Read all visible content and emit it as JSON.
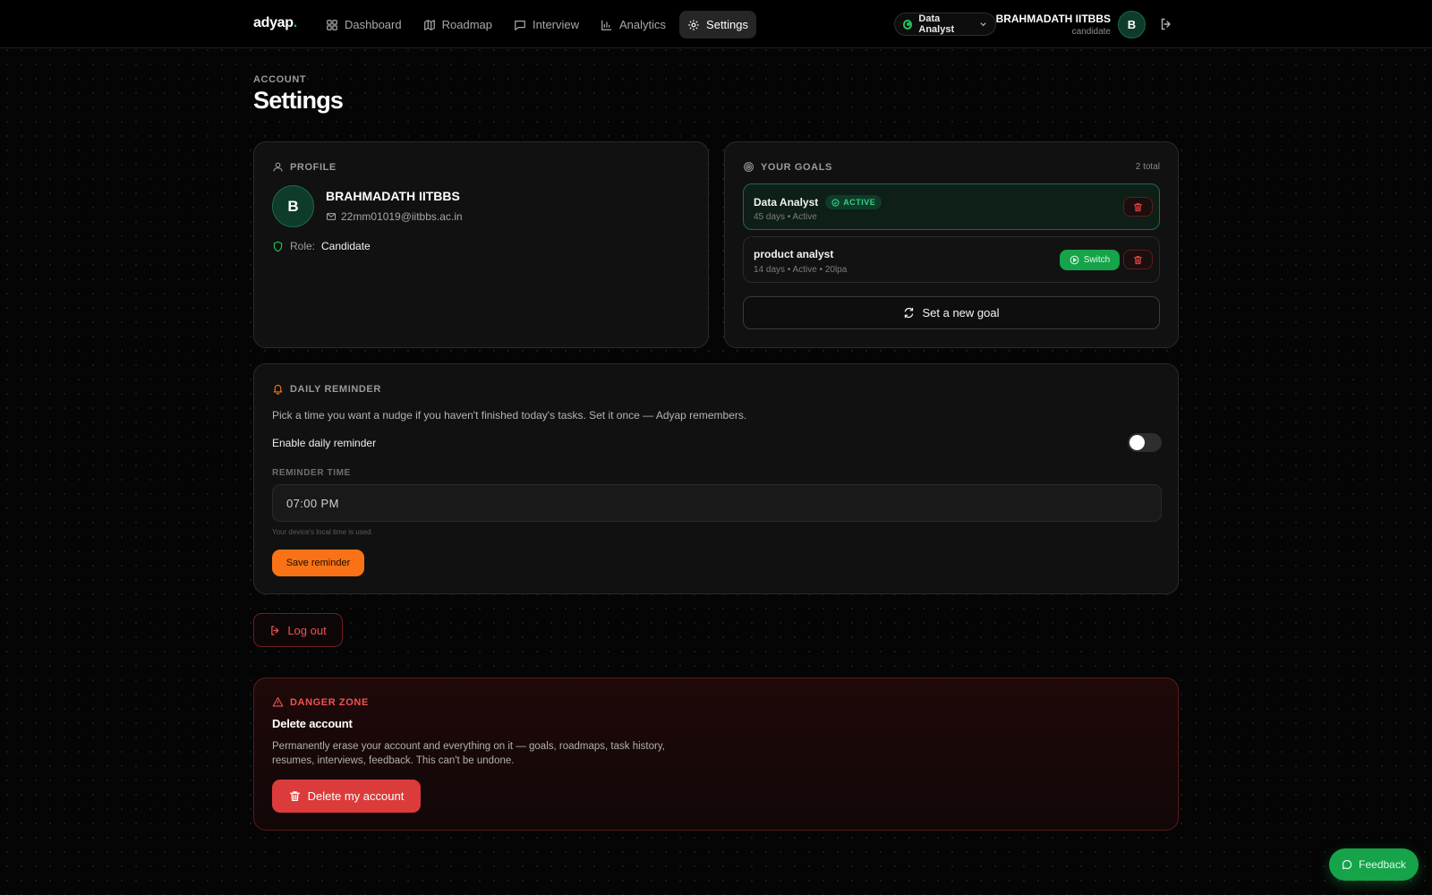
{
  "header": {
    "brand": "adyap",
    "brand_dot": ".",
    "nav": [
      {
        "label": "Dashboard",
        "icon": "grid-icon"
      },
      {
        "label": "Roadmap",
        "icon": "map-icon"
      },
      {
        "label": "Interview",
        "icon": "chat-icon"
      },
      {
        "label": "Analytics",
        "icon": "bar-chart-icon"
      },
      {
        "label": "Settings",
        "icon": "gear-icon",
        "active": true
      }
    ],
    "goal_selector": "Data Analyst",
    "user_name": "BRAHMADATH IITBBS",
    "user_role": "candidate",
    "avatar_initial": "B"
  },
  "page": {
    "eyebrow": "ACCOUNT",
    "title": "Settings"
  },
  "profile": {
    "label": "PROFILE",
    "initial": "B",
    "name": "BRAHMADATH IITBBS",
    "email": "22mm01019@iitbbs.ac.in",
    "role_key": "Role:",
    "role_value": "Candidate"
  },
  "goals": {
    "label": "YOUR GOALS",
    "total": "2 total",
    "items": [
      {
        "title": "Data Analyst",
        "badge": "ACTIVE",
        "meta": "45 days • Active"
      },
      {
        "title": "product analyst",
        "meta": "14 days • Active • 20lpa",
        "switch_label": "Switch"
      }
    ],
    "new_goal_label": "Set a new goal"
  },
  "reminder": {
    "label": "DAILY REMINDER",
    "description": "Pick a time you want a nudge if you haven't finished today's tasks. Set it once — Adyap remembers.",
    "enable_label": "Enable daily reminder",
    "enabled": false,
    "time_label": "REMINDER TIME",
    "time_value": "07:00 PM",
    "hint": "Your device's local time is used.",
    "save_label": "Save reminder"
  },
  "logout_label": "Log out",
  "danger": {
    "label": "DANGER ZONE",
    "title": "Delete account",
    "description": "Permanently erase your account and everything on it — goals, roadmaps, task history, resumes, interviews, feedback. This can't be undone.",
    "button_label": "Delete my account"
  },
  "feedback_label": "Feedback",
  "colors": {
    "accent_green": "#22c55e",
    "accent_orange": "#f97316",
    "danger_red": "#dc3b3b"
  }
}
